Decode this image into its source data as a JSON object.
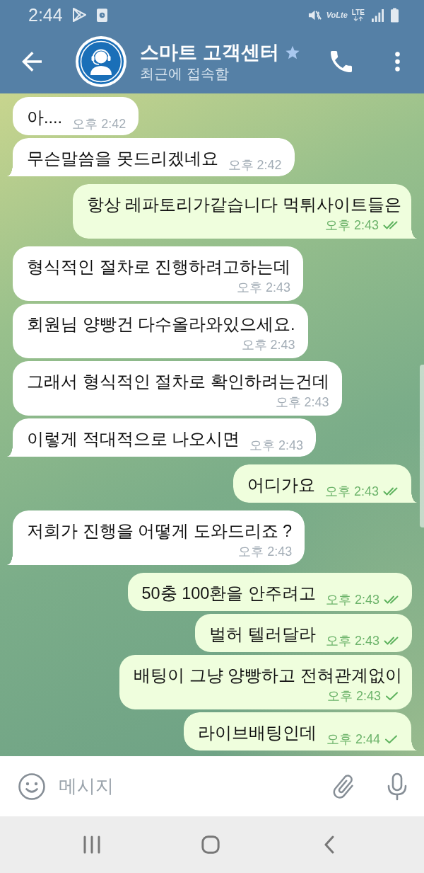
{
  "status_bar": {
    "time": "2:44",
    "volte_label": "VoLte",
    "network_label": "LTE"
  },
  "header": {
    "title": "스마트 고객센터",
    "subtitle": "최근에 접속함"
  },
  "messages": [
    {
      "kind": "incoming",
      "text": "아....",
      "time": "오후 2:42"
    },
    {
      "kind": "incoming",
      "text": "무슨말씀을 못드리겠네요",
      "time": "오후 2:42"
    },
    {
      "kind": "outgoing",
      "text": "항상 레파토리가같습니다 먹튀사이트들은",
      "time": "오후 2:43",
      "read": true
    },
    {
      "kind": "incoming",
      "text": "형식적인 절차로 진행하려고하는데",
      "time": "오후 2:43"
    },
    {
      "kind": "incoming",
      "text": "회원님 양빵건 다수올라와있으세요.",
      "time": "오후 2:43"
    },
    {
      "kind": "incoming",
      "text": "그래서 형식적인 절차로 확인하려는건데",
      "time": "오후 2:43"
    },
    {
      "kind": "incoming",
      "text": "이렇게 적대적으로 나오시면",
      "time": "오후 2:43"
    },
    {
      "kind": "outgoing",
      "text": "어디가요",
      "time": "오후 2:43",
      "read": true
    },
    {
      "kind": "incoming",
      "text": "저희가 진행을 어떻게 도와드리죠 ?",
      "time": "오후 2:43"
    },
    {
      "kind": "outgoing",
      "text": "50충 100환을 안주려고",
      "time": "오후 2:43",
      "read": true
    },
    {
      "kind": "outgoing",
      "text": "벌허 텔러달라",
      "time": "오후 2:43",
      "read": true
    },
    {
      "kind": "outgoing",
      "text": "배팅이 그냥 양빵하고 전혀관계없이",
      "time": "오후 2:43",
      "read": false
    },
    {
      "kind": "outgoing",
      "text": "라이브배팅인데",
      "time": "오후 2:44",
      "read": false
    }
  ],
  "composer": {
    "placeholder": "메시지"
  }
}
